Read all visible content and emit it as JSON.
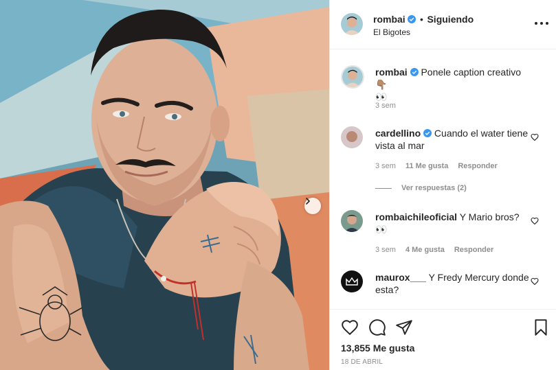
{
  "post": {
    "author": "rombai",
    "follow_separator": "•",
    "follow_status": "Siguiendo",
    "location": "El Bigotes",
    "caption": "Ponele caption creativo 👇🏽",
    "caption_emoji": "👀",
    "caption_time": "3 sem"
  },
  "comments": [
    {
      "user": "cardellino",
      "verified": true,
      "text": "Cuando el water tiene vista al mar",
      "time": "3 sem",
      "likes": "11 Me gusta",
      "reply": "Responder",
      "view_replies": "Ver respuestas (2)"
    },
    {
      "user": "rombaichileoficial",
      "verified": false,
      "text": "Y Mario bros?",
      "emoji": "👀",
      "time": "3 sem",
      "likes": "4 Me gusta",
      "reply": "Responder"
    },
    {
      "user": "maurox___",
      "verified": false,
      "text": "Y Fredy Mercury donde esta?"
    }
  ],
  "footer": {
    "likes": "13,855 Me gusta",
    "date": "18 DE ABRIL"
  },
  "icons": {
    "verified": "verified-badge-icon",
    "more": "more-options-icon",
    "next": "chevron-right-icon",
    "like": "heart-icon",
    "comment": "comment-icon",
    "share": "share-icon",
    "save": "bookmark-icon"
  },
  "colors": {
    "verified_blue": "#3897f0",
    "text": "#262626",
    "muted": "#8e8e8e",
    "border": "#efefef"
  }
}
